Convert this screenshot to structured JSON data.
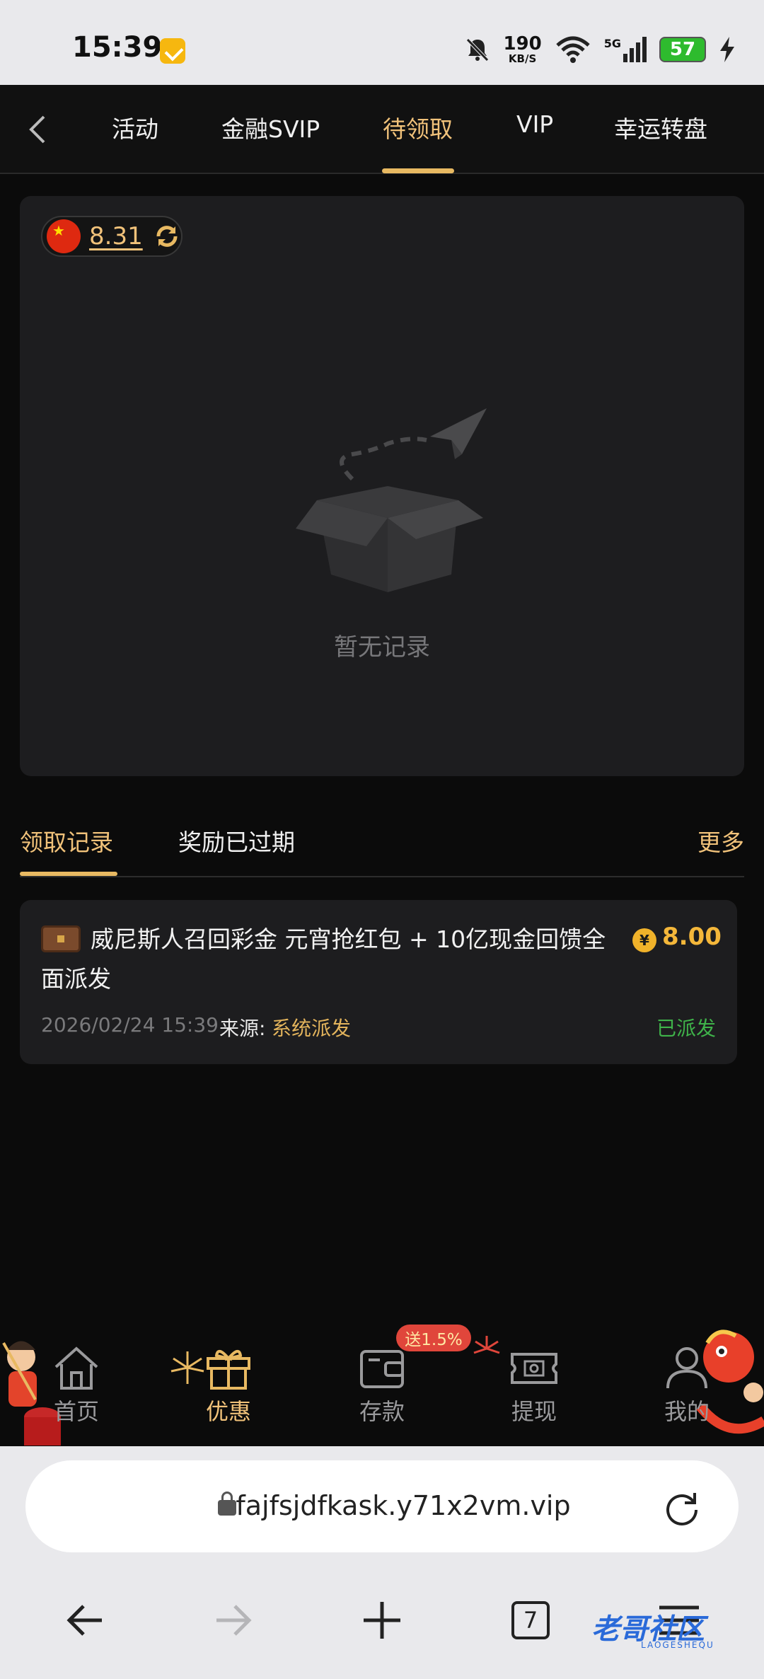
{
  "status_bar": {
    "time": "15:39",
    "net_speed": "190",
    "net_unit": "KB/S",
    "signal": "5G",
    "battery": "57"
  },
  "top_nav": {
    "tabs": [
      {
        "label": "活动"
      },
      {
        "label": "金融SVIP"
      },
      {
        "label": "待领取",
        "active": true
      },
      {
        "label": "VIP"
      },
      {
        "label": "幸运转盘"
      }
    ]
  },
  "balance": {
    "value": "8.31",
    "flag": "china-flag-icon"
  },
  "empty_state": {
    "text": "暂无记录"
  },
  "record_tabs": {
    "tabs": [
      {
        "label": "领取记录",
        "active": true
      },
      {
        "label": "奖励已过期"
      }
    ],
    "more": "更多"
  },
  "records": [
    {
      "title": "威尼斯人召回彩金 元宵抢红包 + 10亿现金回馈全面派发",
      "amount": "8.00",
      "currency_symbol": "¥",
      "date": "2026/02/24 15:39",
      "source_label": "来源:",
      "source": "系统派发",
      "status": "已派发"
    }
  ],
  "app_nav": {
    "items": [
      {
        "label": "首页",
        "icon": "home-icon"
      },
      {
        "label": "优惠",
        "icon": "gift-icon",
        "active": true
      },
      {
        "label": "存款",
        "icon": "wallet-icon"
      },
      {
        "label": "提现",
        "icon": "withdraw-icon"
      },
      {
        "label": "我的",
        "icon": "user-icon"
      }
    ],
    "promo_badge": "送1.5%"
  },
  "browser": {
    "url": "fajfsjdfkask.y71x2vm.vip",
    "tab_count": "7"
  },
  "watermark": {
    "text": "老哥社区",
    "sub": "LAOGESHEQU"
  },
  "colors": {
    "accent_gold": "#f1c27a",
    "success_green": "#3fb34a",
    "background": "#0b0b0b",
    "card": "#1d1d1f"
  }
}
